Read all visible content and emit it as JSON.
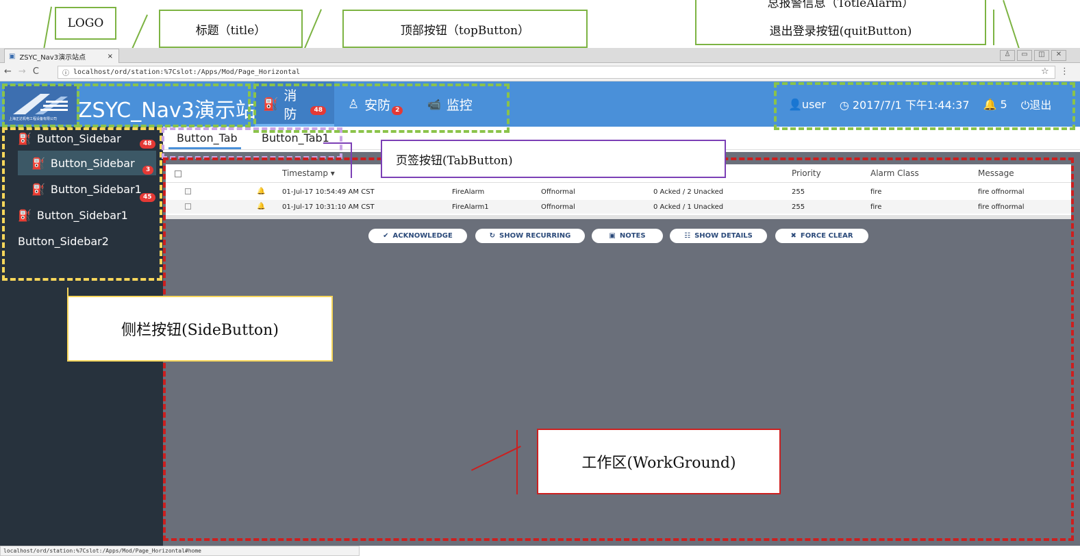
{
  "annotations": {
    "logo": "LOGO",
    "title": "标题（title）",
    "top_button": "顶部按钮（topButton）",
    "total_alarm": "总报警信息（TotleAlarm）",
    "quit_button": "退出登录按钮(quitButton)",
    "tab_button": "页签按钮(TabButton)",
    "side_button": "侧栏按钮(SideButton)",
    "work_ground": "工作区(WorkGround)"
  },
  "browser": {
    "tab_title": "ZSYC_Nav3演示站点",
    "tab_close": "×",
    "url": "localhost/ord/station:%7Cslot:/Apps/Mod/Page_Horizontal",
    "status_url": "localhost/ord/station:%7Cslot:/Apps/Mod/Page_Horizontal#home"
  },
  "header": {
    "logo_caption": "上海正达机电工程设备有限公司",
    "title": "ZSYC_Nav3演示站点",
    "top_buttons": [
      {
        "label": "消防",
        "badge": "48"
      },
      {
        "label": "安防",
        "badge": "2"
      },
      {
        "label": "监控",
        "badge": ""
      }
    ],
    "user": "user",
    "datetime": "2017/7/1 下午1:44:37",
    "alarm_count": "5",
    "quit_label": "退出"
  },
  "sidebar": {
    "items": [
      {
        "label": "Button_Sidebar",
        "badge": "48"
      },
      {
        "label": "Button_Sidebar",
        "badge": "3"
      },
      {
        "label": "Button_Sidebar1",
        "badge": "45"
      },
      {
        "label": "Button_Sidebar1",
        "badge": ""
      },
      {
        "label": "Button_Sidebar2",
        "badge": ""
      }
    ]
  },
  "tabs": [
    "Button_Tab",
    "Button_Tab1"
  ],
  "alarm_table": {
    "columns": [
      "Timestamp ▾",
      "Priority",
      "Alarm Class",
      "Message"
    ],
    "rows": [
      {
        "timestamp": "01-Jul-17 10:54:49 AM CST",
        "source": "FireAlarm",
        "state": "Offnormal",
        "ack": "0 Acked / 2 Unacked",
        "priority": "255",
        "class": "fire",
        "message": "fire offnormal"
      },
      {
        "timestamp": "01-Jul-17 10:31:10 AM CST",
        "source": "FireAlarm1",
        "state": "Offnormal",
        "ack": "0 Acked / 1 Unacked",
        "priority": "255",
        "class": "fire",
        "message": "fire offnormal"
      }
    ]
  },
  "actions": [
    "ACKNOWLEDGE",
    "SHOW RECURRING",
    "NOTES",
    "SHOW DETAILS",
    "FORCE CLEAR"
  ],
  "colors": {
    "header_blue": "#4a90d9",
    "sidebar_dark": "#27323d",
    "work_gray": "#6a6f7a",
    "annotation_green": "#7cb342",
    "annotation_yellow": "#f7d65a",
    "annotation_purple": "#c9a4e6",
    "annotation_red": "#cc1f1f",
    "badge_red": "#e53935"
  }
}
